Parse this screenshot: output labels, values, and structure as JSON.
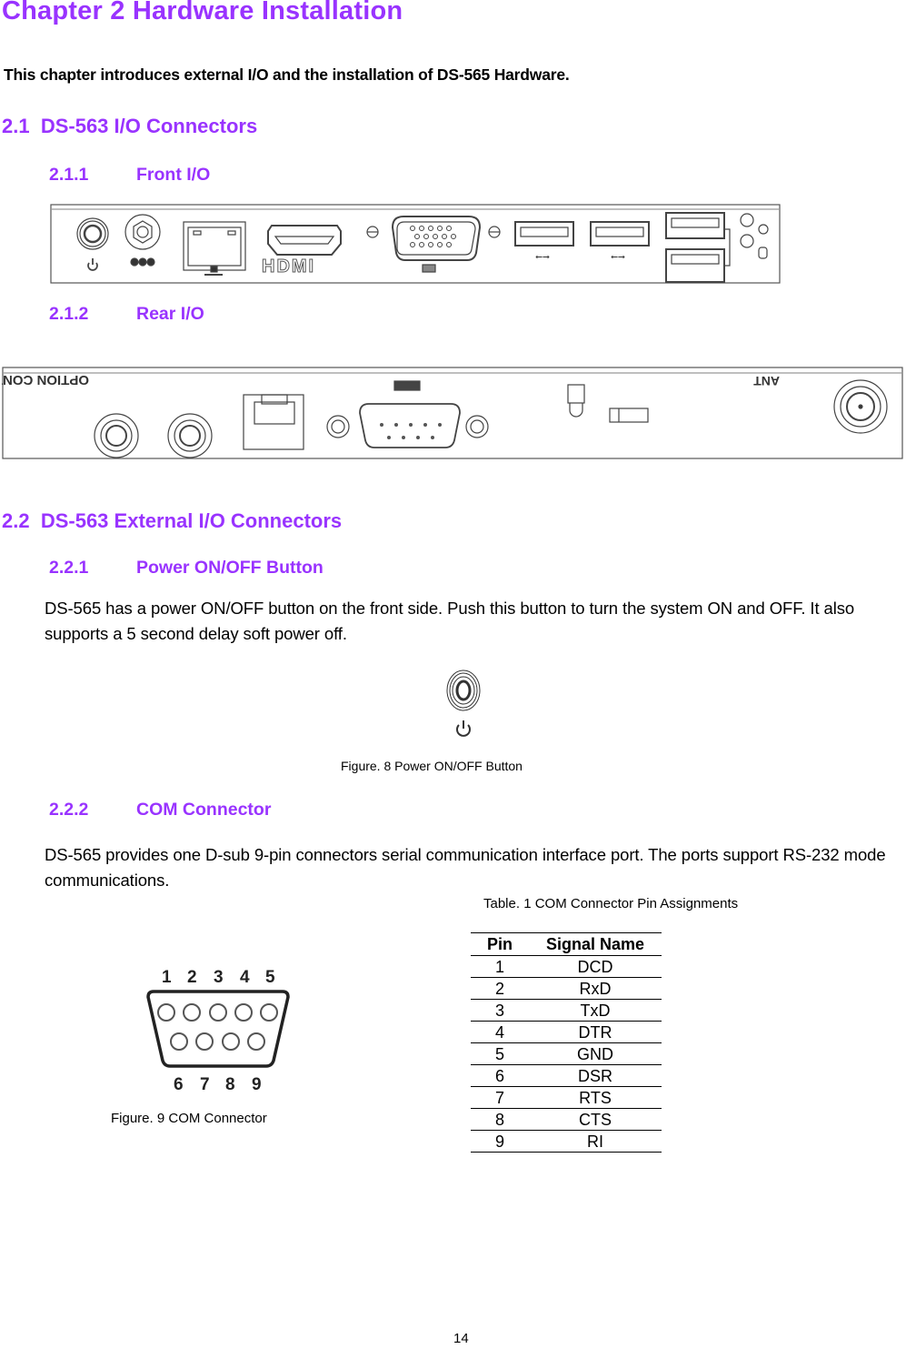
{
  "heading": "Chapter 2 Hardware Installation",
  "intro": "This chapter introduces external I/O and the installation of DS-565 Hardware.",
  "section_2_1": {
    "number": "2.1",
    "title": "DS-563 I/O Connectors",
    "front": {
      "number": "2.1.1",
      "title": "Front I/O",
      "labels": {
        "hdmi_logo": "HDMI"
      }
    },
    "rear": {
      "number": "2.1.2",
      "title": "Rear I/O",
      "labels": {
        "option_control": "OPTION CONTROL",
        "ant": "ANT"
      }
    }
  },
  "section_2_2": {
    "number": "2.2",
    "title": "DS-563 External I/O Connectors",
    "power": {
      "number": "2.2.1",
      "title": "Power ON/OFF Button",
      "body": "DS-565 has a power ON/OFF button on the front side. Push this button to turn the system ON and OFF. It also supports a 5 second delay soft power off.",
      "caption": "Figure. 8 Power ON/OFF Button"
    },
    "com": {
      "number": "2.2.2",
      "title": "COM Connector",
      "body": "DS-565 provides one D-sub 9-pin connectors serial communication interface port. The ports support RS-232 mode communications.",
      "figure_caption": "Figure. 9 COM Connector",
      "connector_top_pins": [
        "1",
        "2",
        "3",
        "4",
        "5"
      ],
      "connector_bottom_pins": [
        "6",
        "7",
        "8",
        "9"
      ],
      "table_caption": "Table. 1 COM Connector Pin Assignments",
      "table": {
        "headers": [
          "Pin",
          "Signal Name"
        ],
        "rows": [
          [
            "1",
            "DCD"
          ],
          [
            "2",
            "RxD"
          ],
          [
            "3",
            "TxD"
          ],
          [
            "4",
            "DTR"
          ],
          [
            "5",
            "GND"
          ],
          [
            "6",
            "DSR"
          ],
          [
            "7",
            "RTS"
          ],
          [
            "8",
            "CTS"
          ],
          [
            "9",
            "RI"
          ]
        ]
      }
    }
  },
  "page_number": "14",
  "colors": {
    "heading": "#9933ff",
    "text": "#000000"
  }
}
